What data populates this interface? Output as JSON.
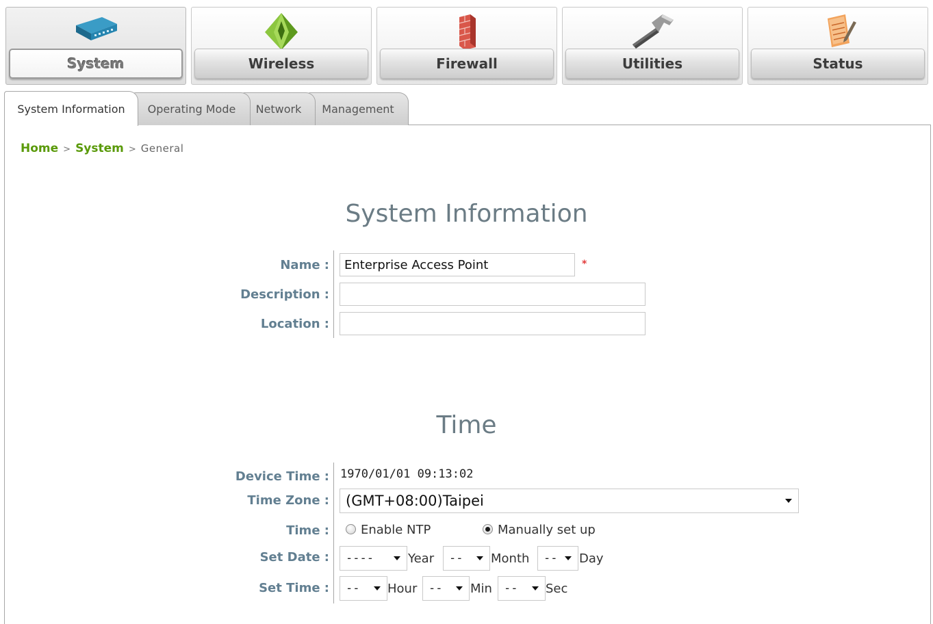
{
  "top_nav": {
    "items": [
      {
        "label": "System",
        "icon": "router-icon",
        "active": true
      },
      {
        "label": "Wireless",
        "icon": "wireless-pyramid-icon",
        "active": false
      },
      {
        "label": "Firewall",
        "icon": "brick-wall-icon",
        "active": false
      },
      {
        "label": "Utilities",
        "icon": "hammer-icon",
        "active": false
      },
      {
        "label": "Status",
        "icon": "notepad-pencil-icon",
        "active": false
      }
    ]
  },
  "tabs": [
    {
      "label": "System Information",
      "active": true
    },
    {
      "label": "Operating Mode",
      "active": false
    },
    {
      "label": "Network",
      "active": false
    },
    {
      "label": "Management",
      "active": false
    }
  ],
  "breadcrumb": {
    "home": "Home",
    "sep1": ">",
    "system": "System",
    "sep2": ">",
    "current": "General"
  },
  "system_info": {
    "title": "System Information",
    "name_label": "Name :",
    "name_value": "Enterprise Access Point",
    "required_mark": "*",
    "description_label": "Description :",
    "description_value": "",
    "location_label": "Location :",
    "location_value": ""
  },
  "time": {
    "title": "Time",
    "device_time_label": "Device Time :",
    "device_time_value": "1970/01/01 09:13:02",
    "time_zone_label": "Time Zone :",
    "time_zone_value": "(GMT+08:00)Taipei",
    "time_label": "Time :",
    "ntp_option": "Enable NTP",
    "manual_option": "Manually set up",
    "selected_option": "manual",
    "set_date_label": "Set Date :",
    "year_value": "----",
    "year_unit": "Year",
    "month_value": "--",
    "month_unit": "Month",
    "day_value": "--",
    "day_unit": "Day",
    "set_time_label": "Set Time :",
    "hour_value": "--",
    "hour_unit": "Hour",
    "min_value": "--",
    "min_unit": "Min",
    "sec_value": "--",
    "sec_unit": "Sec"
  },
  "colors": {
    "breadcrumb_link": "#5a9a0a",
    "label": "#627f91",
    "title": "#6b7c85",
    "required": "#e23a3a"
  }
}
